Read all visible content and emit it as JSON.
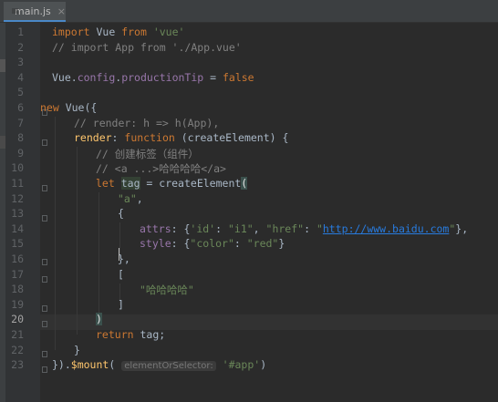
{
  "tab": {
    "filename": "main.js",
    "close": "×"
  },
  "current_line": 20,
  "lines": [
    {
      "n": "1"
    },
    {
      "n": "2"
    },
    {
      "n": "3"
    },
    {
      "n": "4"
    },
    {
      "n": "5"
    },
    {
      "n": "6"
    },
    {
      "n": "7"
    },
    {
      "n": "8"
    },
    {
      "n": "9"
    },
    {
      "n": "10"
    },
    {
      "n": "11"
    },
    {
      "n": "12"
    },
    {
      "n": "13"
    },
    {
      "n": "14"
    },
    {
      "n": "15"
    },
    {
      "n": "16"
    },
    {
      "n": "17"
    },
    {
      "n": "18"
    },
    {
      "n": "19"
    },
    {
      "n": "20"
    },
    {
      "n": "21"
    },
    {
      "n": "22"
    },
    {
      "n": "23"
    }
  ],
  "code": {
    "l1": {
      "a": "import",
      "b": " Vue ",
      "c": "from",
      "d": " ",
      "e": "'vue'"
    },
    "l2": "// import App from './App.vue'",
    "l4": {
      "a": "Vue.",
      "b": "config",
      "c": ".",
      "d": "productionTip",
      "e": " = ",
      "f": "false"
    },
    "l6": {
      "a": "new",
      "b": " Vue({"
    },
    "l7": "// render: h => h(App),",
    "l8": {
      "a": "render",
      "b": ": ",
      "c": "function",
      "d": " (createElement) {"
    },
    "l9": "// 创建标签（组件）",
    "l10": "// <a ...>哈哈哈哈</a>",
    "l11": {
      "a": "let",
      "b": " ",
      "c": "tag",
      "d": " = ",
      "e": "createElement",
      "f": "("
    },
    "l12": {
      "a": "\"a\"",
      "b": ","
    },
    "l13": "{",
    "l14": {
      "a": "attrs",
      "b": ": {",
      "c": "'id'",
      "d": ": ",
      "e": "\"i1\"",
      "f": ", ",
      "g": "\"href\"",
      "h": ": ",
      "i": "\"",
      "j": "http://www.baidu.com",
      "k": "\"",
      "l": "},"
    },
    "l15": {
      "a": "style",
      "b": ": {",
      "c": "\"color\"",
      "d": ": ",
      "e": "\"red\"",
      "f": "}"
    },
    "l16": "},",
    "l17": "[",
    "l18": "\"哈哈哈哈\"",
    "l19": "]",
    "l20": ")",
    "l21": {
      "a": "return",
      "b": " tag;"
    },
    "l22": "}",
    "l23": {
      "a": "}).",
      "b": "$mount",
      "c": "(",
      "d": "elementOrSelector:",
      "e": "'#app'",
      "f": ")"
    }
  },
  "colors": {
    "keyword": "#cc7832",
    "string": "#6a8759",
    "comment": "#808080",
    "property": "#9876aa",
    "function": "#ffc66d",
    "url": "#287bde"
  }
}
